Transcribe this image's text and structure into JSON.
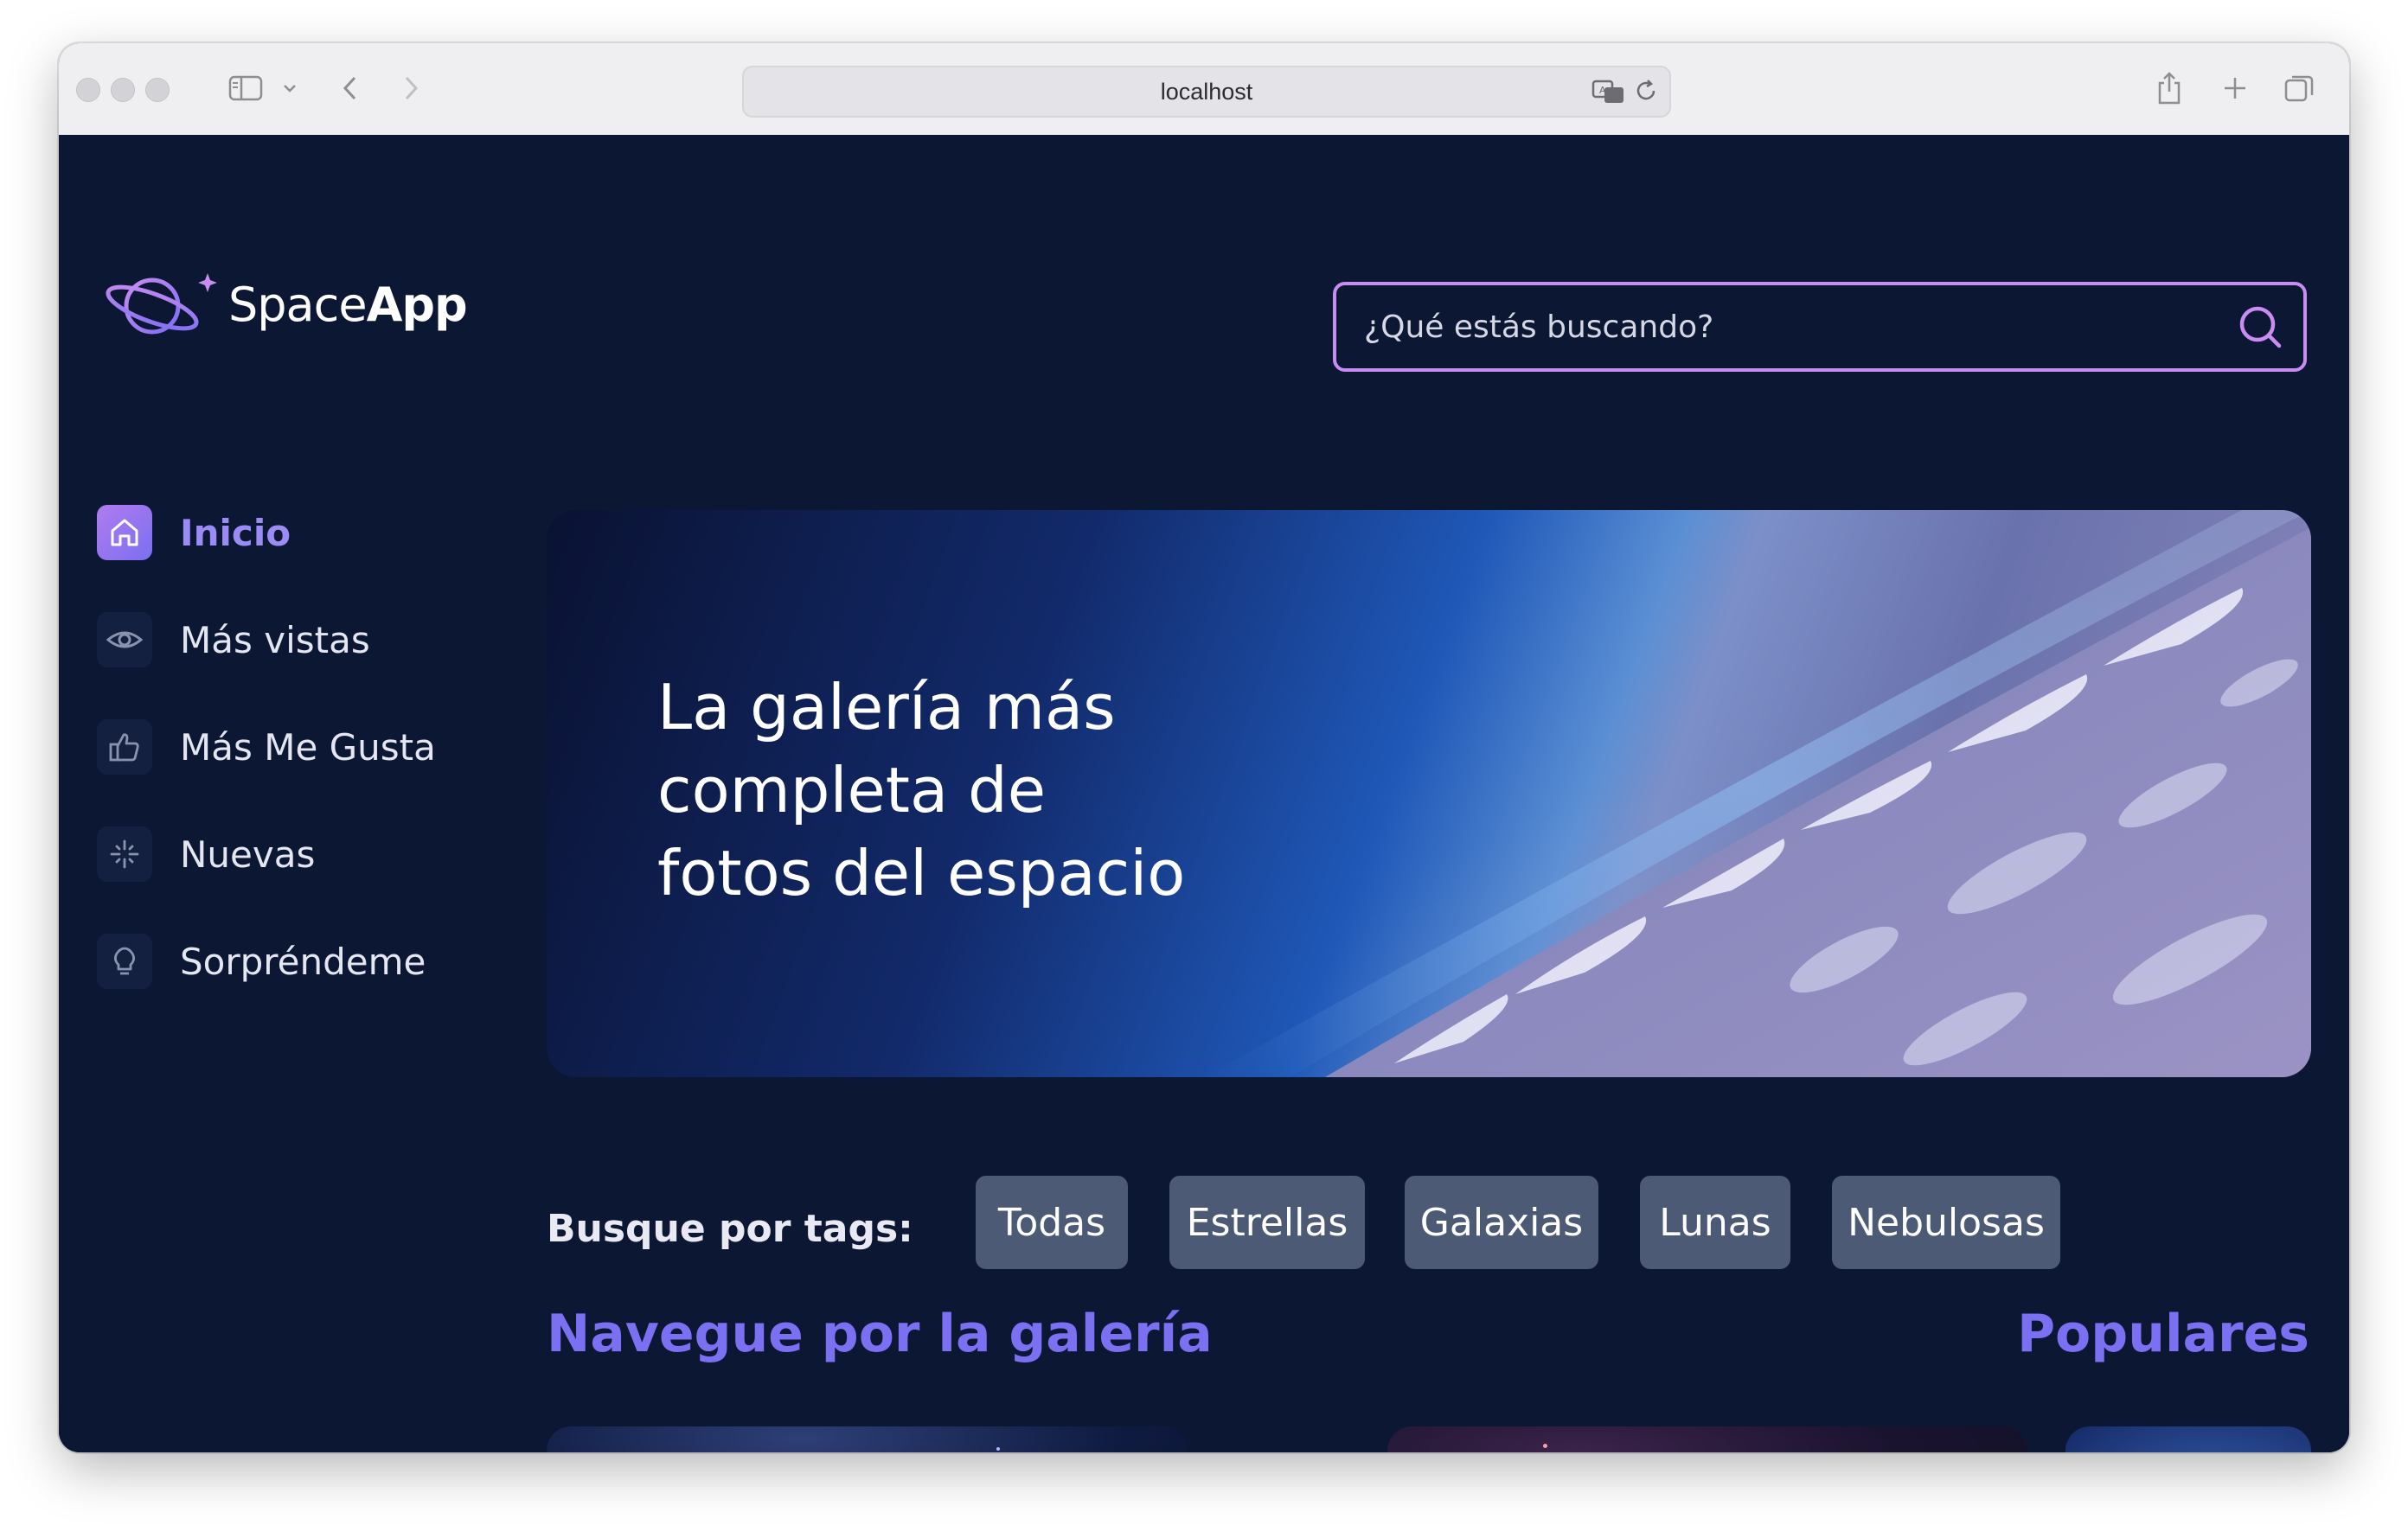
{
  "browser": {
    "url": "localhost"
  },
  "header": {
    "logo_text_light": "Space",
    "logo_text_bold": "App",
    "search_placeholder": "¿Qué estás buscando?"
  },
  "sidebar": {
    "items": [
      {
        "label": "Inicio",
        "icon": "home-icon",
        "active": true
      },
      {
        "label": "Más vistas",
        "icon": "eye-icon",
        "active": false
      },
      {
        "label": "Más Me Gusta",
        "icon": "thumbs-up-icon",
        "active": false
      },
      {
        "label": "Nuevas",
        "icon": "sparkle-icon",
        "active": false
      },
      {
        "label": "Sorpréndeme",
        "icon": "lightbulb-icon",
        "active": false
      }
    ]
  },
  "banner": {
    "title": "La galería más\ncompleta de\nfotos del espacio"
  },
  "tags": {
    "label": "Busque por tags:",
    "items": [
      "Todas",
      "Estrellas",
      "Galaxias",
      "Lunas",
      "Nebulosas"
    ]
  },
  "gallery": {
    "heading": "Navegue por la galería",
    "popular_heading": "Populares"
  },
  "colors": {
    "background": "#0b1733",
    "accent": "#7b6ff2",
    "search_border": "#c98cf1",
    "tag_bg": "#4c5a76"
  }
}
